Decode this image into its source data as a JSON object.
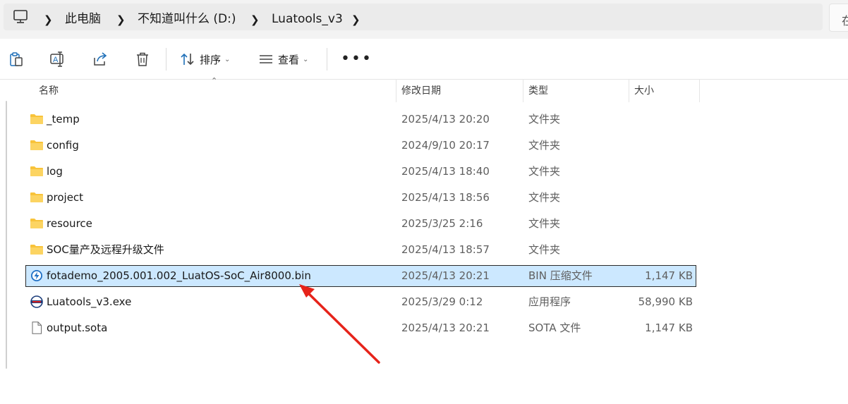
{
  "address_bar": {
    "crumbs": [
      "此电脑",
      "不知道叫什么 (D:)",
      "Luatools_v3"
    ],
    "search_placeholder": "在"
  },
  "toolbar": {
    "sort_label": "排序",
    "view_label": "查看",
    "more_label": "•••"
  },
  "columns": {
    "name": "名称",
    "modified": "修改日期",
    "type": "类型",
    "size": "大小"
  },
  "files": [
    {
      "name": "_temp",
      "modified": "2025/4/13 20:20",
      "type": "文件夹",
      "size": "",
      "icon": "folder-icon"
    },
    {
      "name": "config",
      "modified": "2024/9/10 20:17",
      "type": "文件夹",
      "size": "",
      "icon": "folder-icon"
    },
    {
      "name": "log",
      "modified": "2025/4/13 18:40",
      "type": "文件夹",
      "size": "",
      "icon": "folder-icon"
    },
    {
      "name": "project",
      "modified": "2025/4/13 18:56",
      "type": "文件夹",
      "size": "",
      "icon": "folder-icon"
    },
    {
      "name": "resource",
      "modified": "2025/3/25 2:16",
      "type": "文件夹",
      "size": "",
      "icon": "folder-icon"
    },
    {
      "name": "SOC量产及远程升级文件",
      "modified": "2025/4/13 18:57",
      "type": "文件夹",
      "size": "",
      "icon": "folder-icon"
    },
    {
      "name": "fotademo_2005.001.002_LuatOS-SoC_Air8000.bin",
      "modified": "2025/4/13 20:21",
      "type": "BIN 压缩文件",
      "size": "1,147 KB",
      "icon": "bin-file-icon",
      "selected": true
    },
    {
      "name": "Luatools_v3.exe",
      "modified": "2025/3/29 0:12",
      "type": "应用程序",
      "size": "58,990 KB",
      "icon": "exe-app-icon"
    },
    {
      "name": "output.sota",
      "modified": "2025/4/13 20:21",
      "type": "SOTA 文件",
      "size": "1,147 KB",
      "icon": "generic-file-icon"
    }
  ],
  "colors": {
    "selection": "#cce8ff",
    "folder": "#f8c33a",
    "arrow": "#e6231a"
  }
}
